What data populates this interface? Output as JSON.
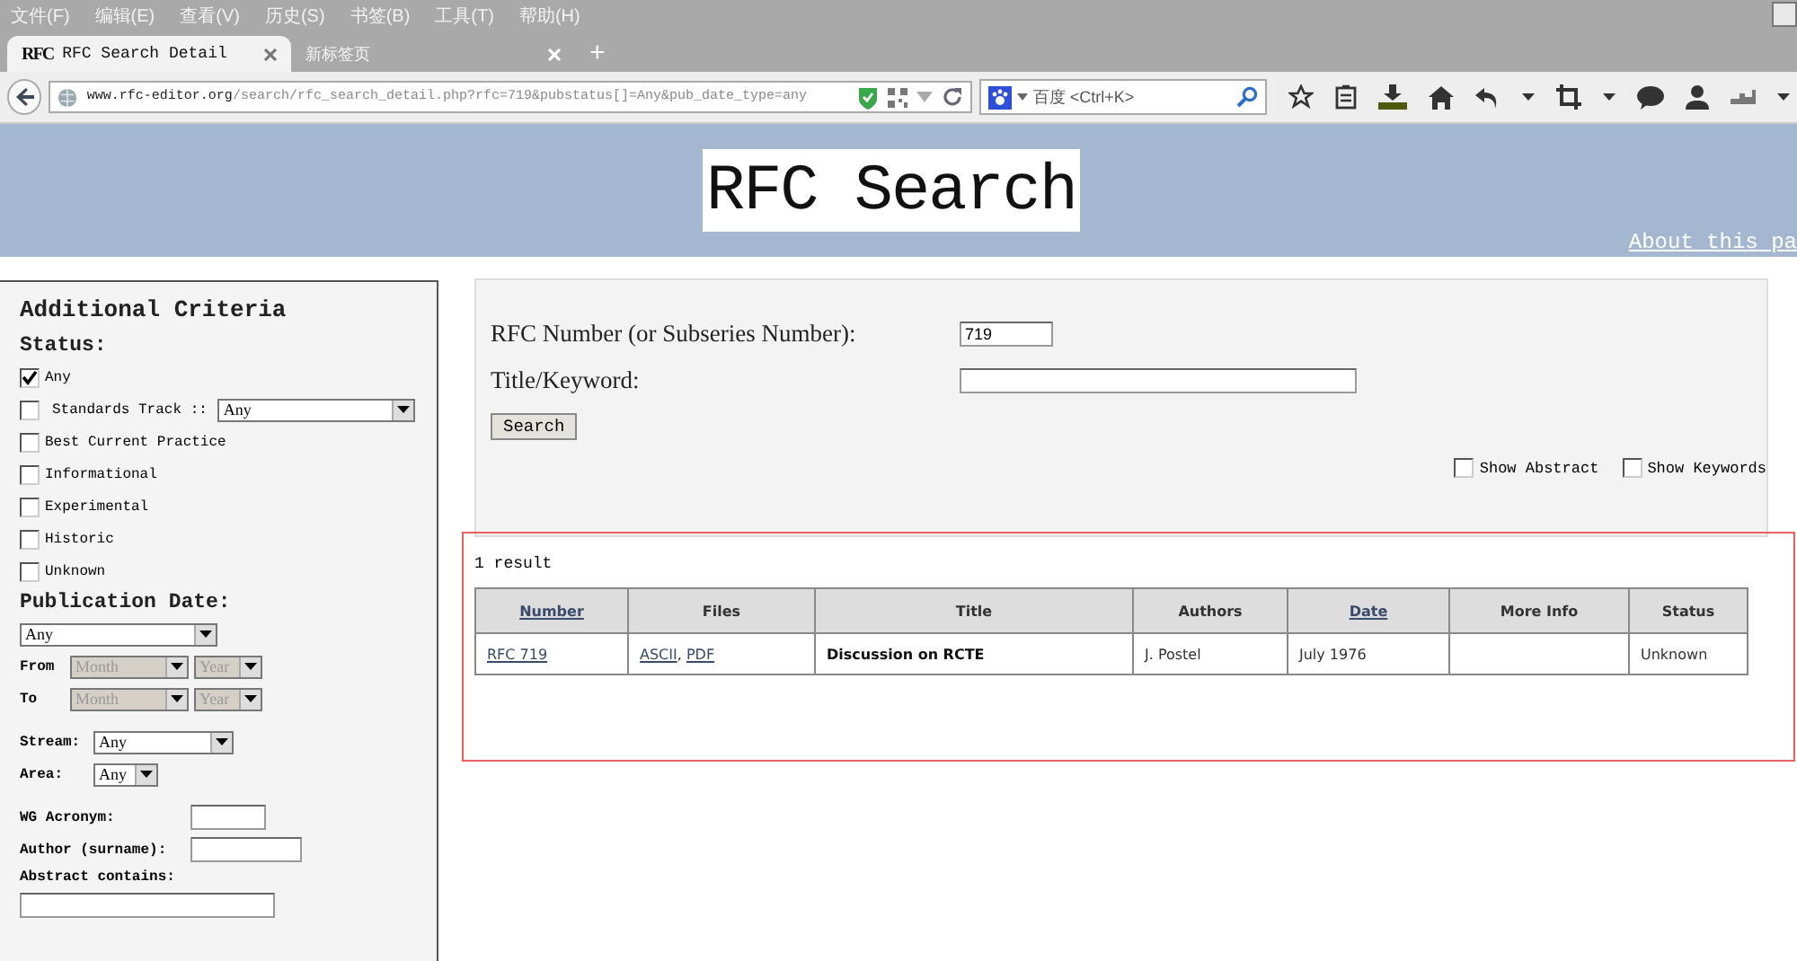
{
  "browser": {
    "menu": [
      "文件(F)",
      "编辑(E)",
      "查看(V)",
      "历史(S)",
      "书签(B)",
      "工具(T)",
      "帮助(H)"
    ],
    "tabs": [
      {
        "label": "RFC Search Detail",
        "selected": true,
        "favicon": "RFC"
      },
      {
        "label": "新标签页",
        "selected": false
      }
    ],
    "new_tab": "+",
    "address": {
      "host": "www.rfc-editor.org",
      "path": "/search/rfc_search_detail.php?rfc=719&pubstatus[]=Any&pub_date_type=any"
    },
    "search": {
      "placeholder": "百度 <Ctrl+K>"
    }
  },
  "banner": {
    "logo": "RFC Search",
    "link": "About this pa"
  },
  "sidebar": {
    "title": "Additional Criteria",
    "status_heading": "Status:",
    "status_options": [
      {
        "label": "Any",
        "checked": true,
        "kind": "checkbox"
      },
      {
        "label": "Standards Track ::",
        "checked": false,
        "kind": "checkbox-select",
        "select": "Any"
      },
      {
        "label": "Best Current Practice",
        "checked": false,
        "kind": "checkbox"
      },
      {
        "label": "Informational",
        "checked": false,
        "kind": "checkbox"
      },
      {
        "label": "Experimental",
        "checked": false,
        "kind": "checkbox"
      },
      {
        "label": "Historic",
        "checked": false,
        "kind": "checkbox"
      },
      {
        "label": "Unknown",
        "checked": false,
        "kind": "checkbox"
      }
    ],
    "date_heading": "Publication Date:",
    "date_select": "Any",
    "date_ranges": [
      {
        "label": "From",
        "month": "Month",
        "year": "Year",
        "disabled": true
      },
      {
        "label": "To",
        "month": "Month",
        "year": "Year",
        "disabled": true
      }
    ],
    "stream": {
      "label": "Stream:",
      "value": "Any"
    },
    "area": {
      "label": "Area:",
      "value": "Any"
    },
    "wg_acronym": {
      "label": "WG Acronym:"
    },
    "author": {
      "label": "Author (surname):"
    },
    "abstract": {
      "label": "Abstract contains:"
    }
  },
  "search_form": {
    "rfc_label": "RFC Number (or Subseries Number):",
    "rfc_value": "719",
    "title_label": "Title/Keyword:",
    "button": "Search",
    "options": [
      {
        "label": "Show Abstract",
        "checked": false
      },
      {
        "label": "Show Keywords",
        "checked": false
      }
    ]
  },
  "results": {
    "count": "1 result",
    "columns": [
      {
        "label": "Number",
        "sortable": true
      },
      {
        "label": "Files",
        "sortable": false
      },
      {
        "label": "Title",
        "sortable": false
      },
      {
        "label": "Authors",
        "sortable": false
      },
      {
        "label": "Date",
        "sortable": true
      },
      {
        "label": "More Info",
        "sortable": false
      },
      {
        "label": "Status",
        "sortable": false
      }
    ],
    "rows": [
      [
        {
          "kind": "links",
          "links": [
            "RFC 719"
          ]
        },
        {
          "kind": "links",
          "links": [
            "ASCII",
            "PDF"
          ],
          "separator": ","
        },
        {
          "kind": "bold",
          "text": "Discussion on RCTE"
        },
        {
          "kind": "plain",
          "text": "J. Postel"
        },
        {
          "kind": "plain",
          "text": "July 1976"
        },
        {
          "kind": "empty"
        },
        {
          "kind": "plain",
          "text": "Unknown"
        }
      ]
    ]
  }
}
